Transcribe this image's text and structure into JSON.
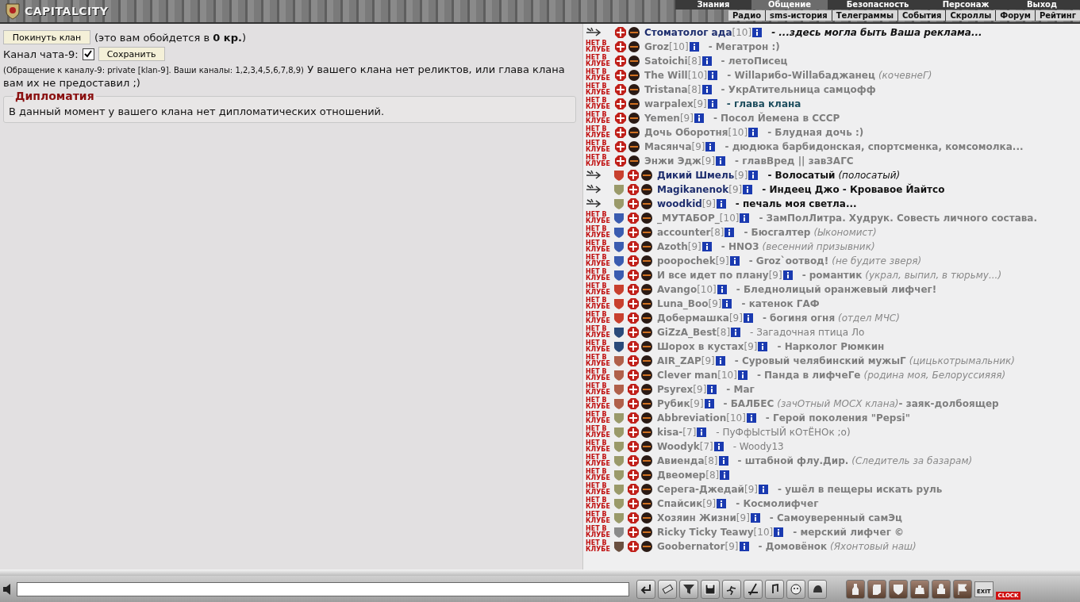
{
  "header": {
    "logo": "CAPITALCITY",
    "menu": [
      {
        "label": "Знания",
        "selected": false
      },
      {
        "label": "Общение",
        "selected": true
      },
      {
        "label": "Безопасность",
        "selected": false
      },
      {
        "label": "Персонаж",
        "selected": false
      },
      {
        "label": "Выход",
        "selected": false
      }
    ],
    "submenu": [
      "Радио",
      "sms-история",
      "Телеграммы",
      "События",
      "Скроллы",
      "Форум",
      "Рейтинг"
    ]
  },
  "clan": {
    "leave_button": "Покинуть клан",
    "cost_note": "(это вам обойдется в **0 кр.**)",
    "channel_label": "Канал чата-9:",
    "channel_checked": true,
    "save_button": "Сохранить",
    "channel_info": "(Обращение к каналу-9: private [klan-9]. Ваши каналы: 1,2,3,4,5,6,7,8,9)",
    "relics_note": "У вашего клана нет реликтов, или глава клана вам их не предоставил ;)",
    "diplomacy": {
      "title": "Дипломатия",
      "text": "В данный момент у вашего клана нет дипломатических отношений."
    }
  },
  "members": [
    {
      "online": true,
      "name": "Стоматолог ада",
      "level": "[10]",
      "status": "- ...здесь могла быть Ваша реклама...",
      "kind": "promo"
    },
    {
      "badge": "НЕТ В КЛУБЕ",
      "online": false,
      "name": "Groz",
      "level": "[10]",
      "status": "- Мегатрон :)",
      "kind": "bold"
    },
    {
      "badge": "НЕТ В КЛУБЕ",
      "online": false,
      "name": "Satoichi",
      "level": "[8]",
      "status": "- летоПисец",
      "kind": "bold"
    },
    {
      "badge": "НЕТ В КЛУБЕ",
      "online": false,
      "name": "The Will",
      "level": "[10]",
      "status": "- Willарибо-Willабаджанец",
      "kind": "bold",
      "note": "(кочевнеГ)"
    },
    {
      "badge": "НЕТ В КЛУБЕ",
      "online": false,
      "name": "Tristana",
      "level": "[8]",
      "status": "- УкрАтительница самцофф",
      "kind": "bold"
    },
    {
      "badge": "НЕТ В КЛУБЕ",
      "online": false,
      "name": "warpalex",
      "level": "[9]",
      "status": "- глава клана",
      "kind": "accent"
    },
    {
      "badge": "НЕТ В КЛУБЕ",
      "online": false,
      "name": "Yemen",
      "level": "[9]",
      "status": "- Посол Йемена в СССР",
      "kind": "bold"
    },
    {
      "badge": "НЕТ В КЛУБЕ",
      "online": false,
      "name": "Дочь Оборотня",
      "level": "[10]",
      "status": "- Блудная дочь :)",
      "kind": "bold"
    },
    {
      "badge": "НЕТ В КЛУБЕ",
      "online": false,
      "name": "Масянча",
      "level": "[9]",
      "status": "- дюдюка барбидонская, спортсменка, комсомолка...",
      "kind": "bold"
    },
    {
      "badge": "НЕТ В КЛУБЕ",
      "online": false,
      "name": "Энжи Эдж",
      "level": "[9]",
      "status": "- главВред || завЗАГС",
      "kind": "bold"
    },
    {
      "color": "#c8402e",
      "online": true,
      "name": "Дикий Шмель",
      "level": "[9]",
      "status": "- Волосатый",
      "kind": "online",
      "note": "(полосатый)"
    },
    {
      "color": "#9a9a6a",
      "online": true,
      "name": "Magikanenok",
      "level": "[9]",
      "status": "- Индеец Джо - Кровавое Йайтсо",
      "kind": "online"
    },
    {
      "color": "#9a9a6a",
      "online": true,
      "name": "woodkid",
      "level": "[9]",
      "status": "- печаль моя светла...",
      "kind": "online"
    },
    {
      "badge": "НЕТ В КЛУБЕ",
      "color": "#3a5cb0",
      "online": false,
      "name": "_МУТАБОР_",
      "level": "[10]",
      "status": "- ЗамПолЛитра. Худрук. Совесть личного состава.",
      "kind": "bold"
    },
    {
      "badge": "НЕТ В КЛУБЕ",
      "color": "#3a5cb0",
      "online": false,
      "name": "accounter",
      "level": "[8]",
      "status": "- Бюсгалтер",
      "kind": "bold",
      "note": "(Ыкономист)"
    },
    {
      "badge": "НЕТ В КЛУБЕ",
      "color": "#3a5cb0",
      "online": false,
      "name": "Azoth",
      "level": "[9]",
      "status": "- HNO3",
      "kind": "bold",
      "note": "(весенний призывник)"
    },
    {
      "badge": "НЕТ В КЛУБЕ",
      "color": "#3a5cb0",
      "online": false,
      "name": "poopochek",
      "level": "[9]",
      "status": "- Groz`оотвод!",
      "kind": "bold",
      "note": "(не будите зверя)"
    },
    {
      "badge": "НЕТ В КЛУБЕ",
      "color": "#3a5cb0",
      "online": false,
      "name": "И все идет по плану",
      "level": "[9]",
      "status": "- романтик",
      "kind": "bold",
      "note": "(украл, выпил, в тюрьму...)"
    },
    {
      "badge": "НЕТ В КЛУБЕ",
      "color": "#c8402e",
      "online": false,
      "name": "Avango",
      "level": "[10]",
      "status": "- Бледнолицый оранжевый лифчег!",
      "kind": "bold"
    },
    {
      "badge": "НЕТ В КЛУБЕ",
      "color": "#c8402e",
      "online": false,
      "name": "Luna_Boo",
      "level": "[9]",
      "status": "- катенок ГАФ",
      "kind": "bold"
    },
    {
      "badge": "НЕТ В КЛУБЕ",
      "color": "#c8402e",
      "online": false,
      "name": "Добермашка",
      "level": "[9]",
      "status": "- богиня огня",
      "kind": "bold",
      "note": "(отдел МЧС)"
    },
    {
      "badge": "НЕТ В КЛУБЕ",
      "color": "#2a4a7a",
      "online": false,
      "name": "GiZzA_Best",
      "level": "[8]",
      "status": "- Загадочная птица Ло",
      "kind": "light"
    },
    {
      "badge": "НЕТ В КЛУБЕ",
      "color": "#2a4a7a",
      "online": false,
      "name": "Шорох в кустах",
      "level": "[9]",
      "status": "- Нарколог Рюмкин",
      "kind": "bold"
    },
    {
      "badge": "НЕТ В КЛУБЕ",
      "color": "#b0604a",
      "online": false,
      "name": "AIR_ZAP",
      "level": "[9]",
      "status": "- Суровый челябинский мужыГ",
      "kind": "bold",
      "note": "(цицькотрымальник)"
    },
    {
      "badge": "НЕТ В КЛУБЕ",
      "color": "#b0604a",
      "online": false,
      "name": "Clever man",
      "level": "[10]",
      "status": "- Панда в лифчеГе",
      "kind": "bold",
      "note": "(родина моя, Белоруссияяя)"
    },
    {
      "badge": "НЕТ В КЛУБЕ",
      "color": "#b0604a",
      "online": false,
      "name": "Psyrex",
      "level": "[9]",
      "status": "- Маг",
      "kind": "bold"
    },
    {
      "badge": "НЕТ В КЛУБЕ",
      "color": "#b0604a",
      "online": false,
      "name": "Рубик",
      "level": "[9]",
      "status": "- БАЛБЕС",
      "kind": "bold",
      "note": "(зачОтный МОСХ клана)",
      "after": "- заяк-долбоящер"
    },
    {
      "badge": "НЕТ В КЛУБЕ",
      "color": "#9a9a6a",
      "online": false,
      "name": "Abbreviation",
      "level": "[10]",
      "status": "- Герой поколения \"Pepsi\"",
      "kind": "bold"
    },
    {
      "badge": "НЕТ В КЛУБЕ",
      "color": "#9a9a6a",
      "online": false,
      "name": "kisa-",
      "level": "[7]",
      "status": "- ПуФфЫстЫЙ кОтЁНОк ;о)",
      "kind": "light"
    },
    {
      "badge": "НЕТ В КЛУБЕ",
      "color": "#9a9a6a",
      "online": false,
      "name": "Woodyk",
      "level": "[7]",
      "status": "- Woody13",
      "kind": "light"
    },
    {
      "badge": "НЕТ В КЛУБЕ",
      "color": "#9a9a6a",
      "online": false,
      "name": "Авиенда",
      "level": "[8]",
      "status": "- штабной флу.Дир.",
      "kind": "bold",
      "note": "(Следитель за базарам)"
    },
    {
      "badge": "НЕТ В КЛУБЕ",
      "color": "#9a9a6a",
      "online": false,
      "name": "Двеомер",
      "level": "[8]"
    },
    {
      "badge": "НЕТ В КЛУБЕ",
      "color": "#9a9a6a",
      "online": false,
      "name": "Серега-Джедай",
      "level": "[9]",
      "status": "- ушёл в пещеры искать руль",
      "kind": "bold"
    },
    {
      "badge": "НЕТ В КЛУБЕ",
      "color": "#9a9a6a",
      "online": false,
      "name": "Спайсик",
      "level": "[9]",
      "status": "- Космолифчег",
      "kind": "bold"
    },
    {
      "badge": "НЕТ В КЛУБЕ",
      "color": "#9a9a6a",
      "online": false,
      "name": "Хозяин Жизни",
      "level": "[9]",
      "status": "- Самоуверенный самЭц",
      "kind": "bold"
    },
    {
      "badge": "НЕТ В КЛУБЕ",
      "color": "#8a8a8a",
      "online": false,
      "name": "Ricky Ticky Teawy",
      "level": "[10]",
      "status": "- мерский лифчег ©",
      "kind": "bold"
    },
    {
      "badge": "НЕТ В КЛУБЕ",
      "color": "#6a5040",
      "online": false,
      "name": "Goobernator",
      "level": "[9]",
      "status": "- Домовёнок",
      "kind": "bold",
      "note": "(Яхонтовый наш)"
    }
  ],
  "footer": {
    "exit_label": "EXIT",
    "clock_label": "CLOCK"
  }
}
